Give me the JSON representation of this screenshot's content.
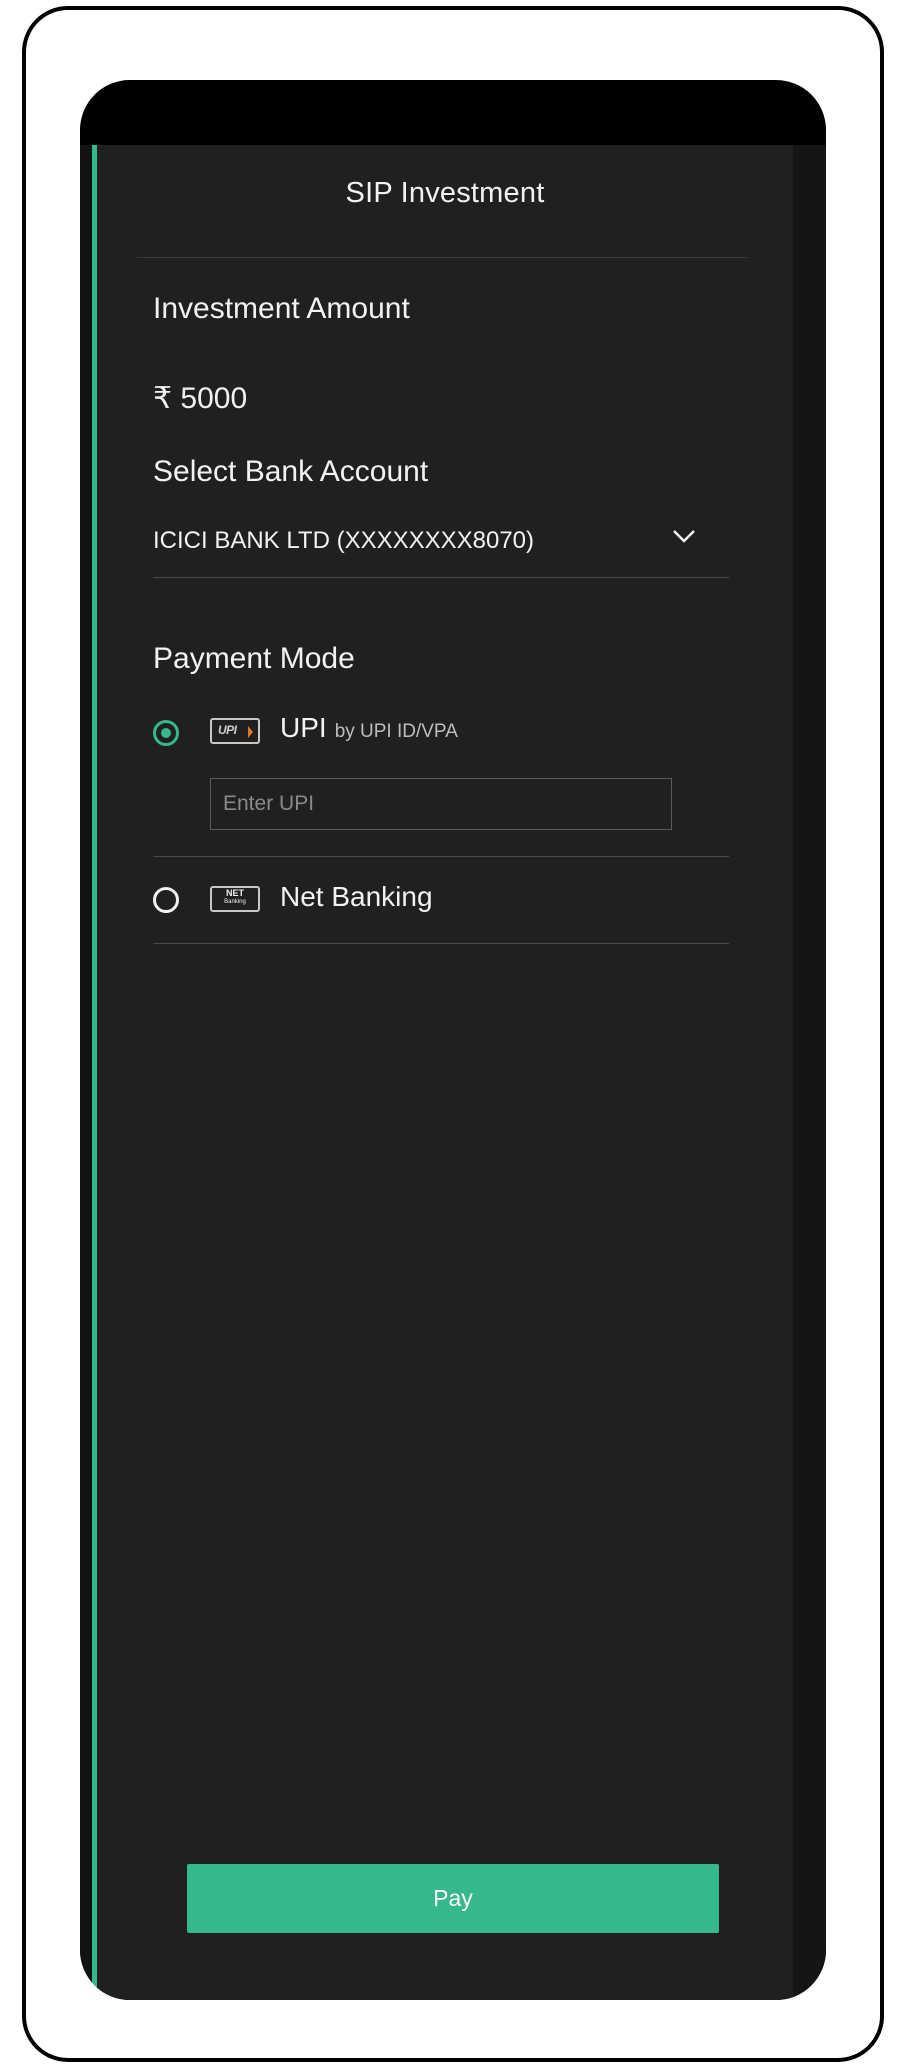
{
  "header": {
    "title": "SIP Investment"
  },
  "investment": {
    "label": "Investment Amount",
    "amount": "₹ 5000"
  },
  "bank": {
    "label": "Select Bank Account",
    "selected": "ICICI BANK LTD (XXXXXXXX8070)",
    "icon": "chevron-down-icon"
  },
  "payment": {
    "label": "Payment Mode",
    "upi": {
      "name": "UPI",
      "sub": "by UPI ID/VPA",
      "logo_text": "UPI",
      "input_placeholder": "Enter UPI",
      "input_value": "",
      "selected": true
    },
    "netbanking": {
      "name": "Net Banking",
      "logo_text": "NET",
      "logo_sub": "Banking",
      "selected": false
    }
  },
  "footer": {
    "pay_label": "Pay"
  },
  "colors": {
    "accent": "#35b88d",
    "panel": "#202020",
    "text": "#f2f2f2"
  }
}
